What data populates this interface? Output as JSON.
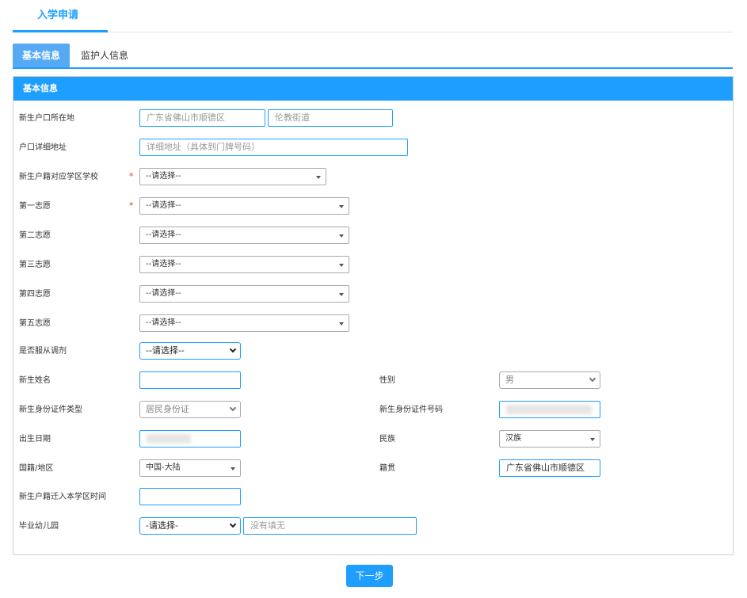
{
  "page": {
    "top_tab": "入学申请",
    "sub_tabs": [
      "基本信息",
      "监护人信息"
    ],
    "panel_title": "基本信息",
    "next_button": "下一步"
  },
  "form": {
    "hukou_location_label": "新生户口所在地",
    "hukou_city_placeholder": "广东省佛山市顺德区",
    "hukou_street_placeholder": "伦教街道",
    "address_label": "户口详细地址",
    "address_placeholder": "详细地址（具体到门牌号码）",
    "district_school_label": "新生户籍对应学区学校",
    "district_school_value": "--请选择--",
    "choice1_label": "第一志愿",
    "choice1_value": "--请选择--",
    "choice2_label": "第二志愿",
    "choice2_value": "--请选择--",
    "choice3_label": "第三志愿",
    "choice3_value": "--请选择--",
    "choice4_label": "第四志愿",
    "choice4_value": "--请选择--",
    "choice5_label": "第五志愿",
    "choice5_value": "--请选择--",
    "obey_label": "是否服从调剂",
    "obey_value": "--请选择--",
    "name_label": "新生姓名",
    "name_value": "",
    "gender_label": "性别",
    "gender_value": "男",
    "id_type_label": "新生身份证件类型",
    "id_type_value": "居民身份证",
    "id_number_label": "新生身份证件号码",
    "birth_label": "出生日期",
    "ethnicity_label": "民族",
    "ethnicity_value": "汉族",
    "nationality_label": "国籍/地区",
    "nationality_value": "中国-大陆",
    "native_place_label": "籍贯",
    "native_place_value": "广东省佛山市顺德区",
    "transfer_time_label": "新生户籍迁入本学区时间",
    "transfer_time_value": "",
    "kindergarten_label": "毕业幼儿园",
    "kindergarten_value": "-请选择-",
    "kindergarten_placeholder": "没有填无",
    "required_mark": "*"
  }
}
